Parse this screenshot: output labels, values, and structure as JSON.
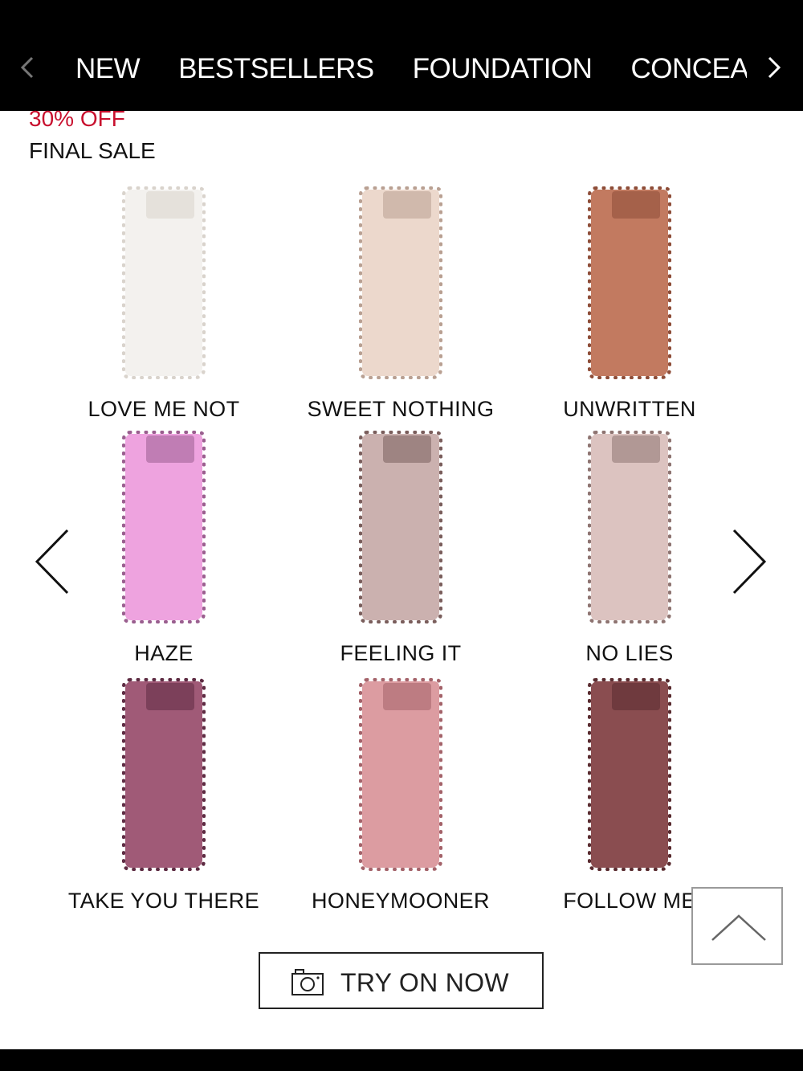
{
  "nav": {
    "items": [
      "NEW",
      "BESTSELLERS",
      "FOUNDATION",
      "CONCEALER"
    ],
    "prev_icon": "chevron-left-icon",
    "next_icon": "chevron-right-icon"
  },
  "promo": {
    "discount": "30% OFF",
    "label": "FINAL SALE",
    "discount_color": "#c8102e"
  },
  "shades": [
    {
      "name": "LOVE ME NOT",
      "color": "#f3f1ee",
      "edge": "#d9d3cc"
    },
    {
      "name": "SWEET NOTHING",
      "color": "#ecd8cc",
      "edge": "#b9a092"
    },
    {
      "name": "UNWRITTEN",
      "color": "#c27a60",
      "edge": "#8e4d38"
    },
    {
      "name": "HAZE",
      "color": "#eea3df",
      "edge": "#9a5f8f"
    },
    {
      "name": "FEELING IT",
      "color": "#cbb1af",
      "edge": "#7a5e5c"
    },
    {
      "name": "NO LIES",
      "color": "#dcc3c0",
      "edge": "#8e7471"
    },
    {
      "name": "TAKE YOU THERE",
      "color": "#a05a77",
      "edge": "#5e2c43"
    },
    {
      "name": "HONEYMOONER",
      "color": "#dc9ca1",
      "edge": "#a4636a"
    },
    {
      "name": "FOLLOW ME",
      "color": "#8a4d50",
      "edge": "#5a2c30"
    }
  ],
  "carousel": {
    "prev_icon": "chevron-left-icon",
    "next_icon": "chevron-right-icon"
  },
  "try_on": {
    "label": "TRY ON NOW",
    "icon": "camera-icon"
  },
  "back_to_top": {
    "icon": "chevron-up-icon"
  }
}
